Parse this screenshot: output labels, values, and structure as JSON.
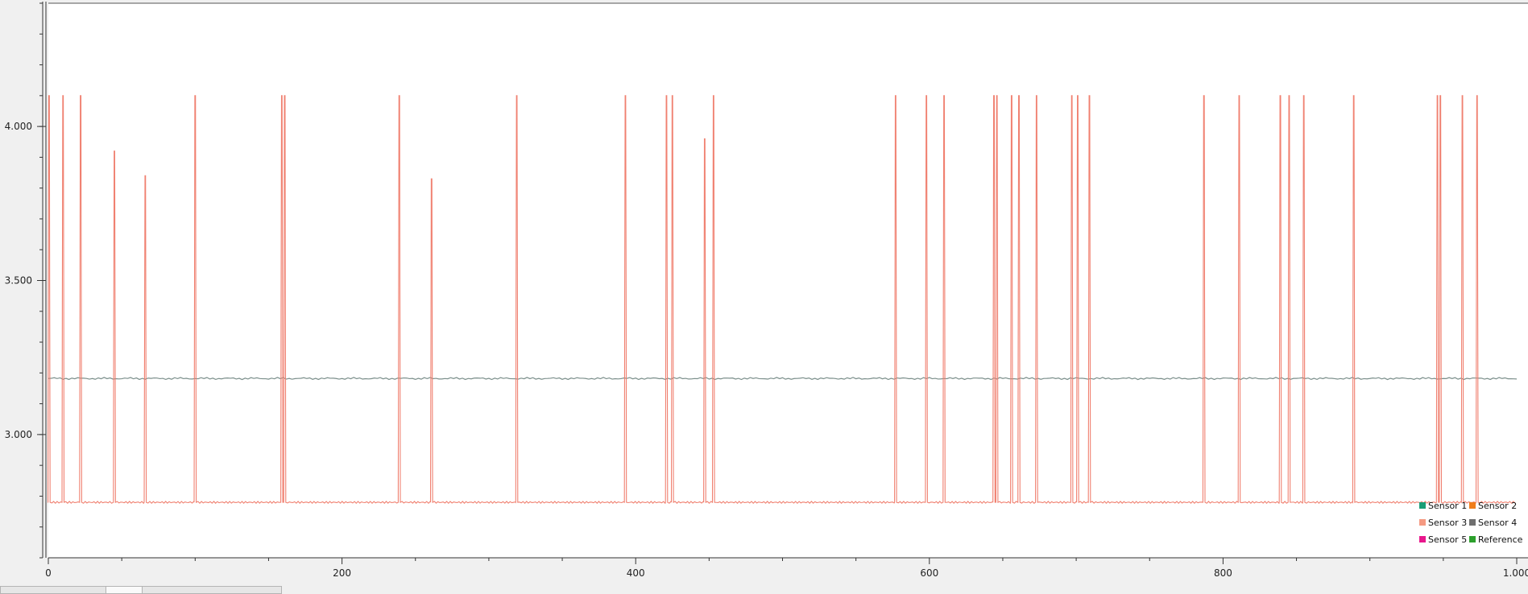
{
  "chart_data": {
    "type": "line",
    "title": "",
    "xlabel": "",
    "ylabel": "",
    "xlim": [
      0,
      1000
    ],
    "ylim": [
      2.6,
      4.4
    ],
    "x_ticks": [
      0,
      200,
      400,
      600,
      800,
      1000
    ],
    "x_tick_labels": [
      "0",
      "200",
      "400",
      "600",
      "800",
      "1.000"
    ],
    "y_ticks": [
      3.0,
      3.5,
      4.0
    ],
    "y_tick_labels": [
      "3.000",
      "3.500",
      "4.000"
    ],
    "grid": false,
    "legend_placement": "bottom-right",
    "legend": [
      {
        "name": "Sensor 1",
        "color": "#1a9e77"
      },
      {
        "name": "Sensor 2",
        "color": "#f07d1a"
      },
      {
        "name": "Sensor 3",
        "color": "#f59a82"
      },
      {
        "name": "Sensor 4",
        "color": "#6f6f6f"
      },
      {
        "name": "Sensor 5",
        "color": "#e8178c"
      },
      {
        "name": "Reference",
        "color": "#2ca02c"
      }
    ],
    "series": [
      {
        "name": "Sensor 3",
        "color": "#f08070",
        "baseline": 2.78,
        "spikes": [
          [
            0.5,
            4.1
          ],
          [
            10,
            4.1
          ],
          [
            22,
            4.1
          ],
          [
            45,
            3.92
          ],
          [
            66,
            3.84
          ],
          [
            100,
            4.1
          ],
          [
            159,
            4.1
          ],
          [
            161,
            4.1
          ],
          [
            239,
            4.1
          ],
          [
            261,
            3.83
          ],
          [
            319,
            4.1
          ],
          [
            393,
            4.1
          ],
          [
            421,
            4.1
          ],
          [
            425,
            4.1
          ],
          [
            447,
            3.96
          ],
          [
            453,
            4.1
          ],
          [
            577,
            4.1
          ],
          [
            598,
            4.1
          ],
          [
            610,
            4.1
          ],
          [
            644,
            4.1
          ],
          [
            646,
            4.1
          ],
          [
            656,
            4.1
          ],
          [
            661,
            4.1
          ],
          [
            673,
            4.1
          ],
          [
            697,
            4.1
          ],
          [
            701,
            4.1
          ],
          [
            709,
            4.1
          ],
          [
            787,
            4.1
          ],
          [
            811,
            4.1
          ],
          [
            839,
            4.1
          ],
          [
            845,
            4.1
          ],
          [
            855,
            4.1
          ],
          [
            889,
            4.1
          ],
          [
            946,
            4.1
          ],
          [
            948,
            4.1
          ],
          [
            963,
            4.1
          ],
          [
            973,
            4.1
          ]
        ]
      },
      {
        "name": "Sensor 4",
        "color": "#7a8e8a",
        "baseline": 3.182
      }
    ]
  }
}
